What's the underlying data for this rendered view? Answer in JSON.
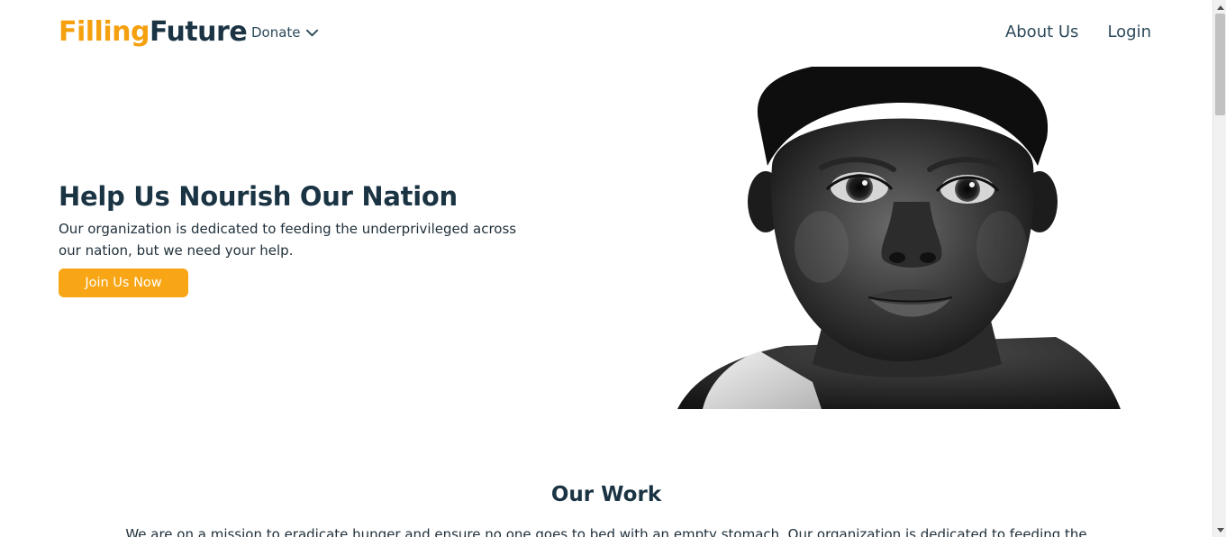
{
  "nav": {
    "logo_part1": "Filling",
    "logo_part2": "Future",
    "donate_label": "Donate",
    "about_label": "About Us",
    "login_label": "Login"
  },
  "hero": {
    "title": "Help Us Nourish Our Nation",
    "description": "Our organization is dedicated to feeding the underprivileged across our nation, but we need your help.",
    "cta_label": "Join Us Now",
    "image_alt": "black and white portrait of a child"
  },
  "work": {
    "title": "Our Work",
    "text": "We are on a mission to eradicate hunger and ensure no one goes to bed with an empty stomach. Our organization is dedicated to feeding the"
  },
  "colors": {
    "brand_orange": "#f5a10f",
    "brand_navy": "#1b3444",
    "button": "#f8a615"
  },
  "icons": {
    "donate_dropdown": "chevron-down-icon",
    "scroll_up": "scroll-up-arrow-icon",
    "scroll_down": "scroll-down-arrow-icon"
  }
}
